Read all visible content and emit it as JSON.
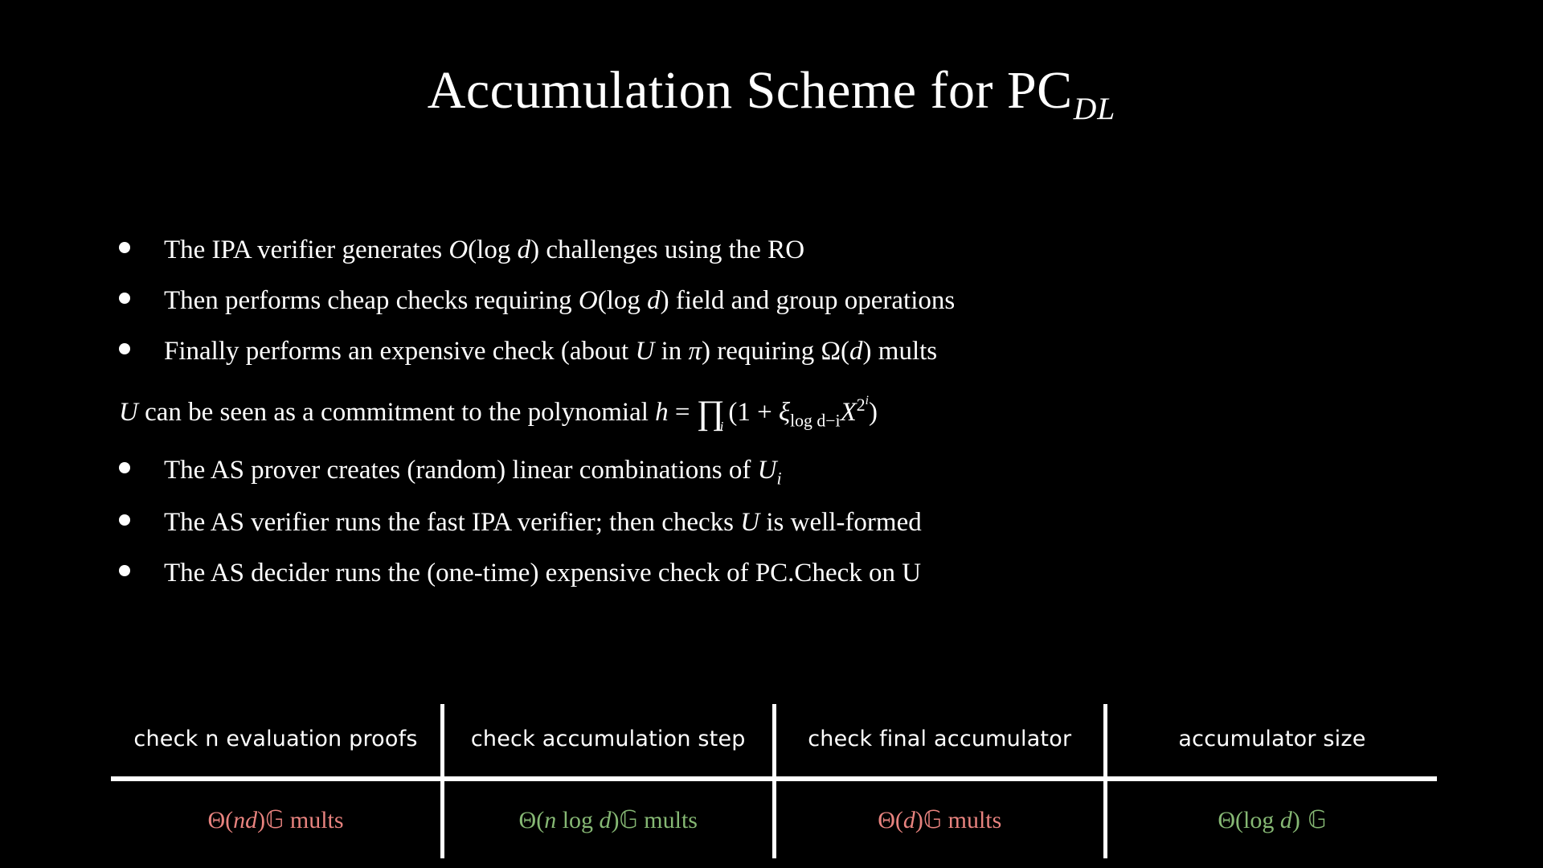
{
  "slide": {
    "background_color": "#000000",
    "text_color": "#ffffff",
    "title_main": "Accumulation Scheme for PC",
    "title_subscript": "DL"
  },
  "bullets": [
    {
      "id": "ipa-verifier-challenges",
      "text_parts": {
        "a": "The IPA verifier generates ",
        "math_O": "O",
        "math_args": "(log ",
        "math_d": "d",
        "math_close": ")",
        "b": " challenges using the RO"
      },
      "plain": "The IPA verifier generates O(log d) challenges using the RO"
    },
    {
      "id": "cheap-checks",
      "text_parts": {
        "a": "Then performs cheap checks requiring ",
        "math_O": "O",
        "math_args": "(log ",
        "math_d": "d",
        "math_close": ")",
        "b": " field and group operations"
      },
      "plain": "Then performs cheap checks requiring O(log d) field and group operations"
    },
    {
      "id": "expensive-check",
      "text_parts": {
        "a": "Finally performs an expensive check (about ",
        "math_U": "U",
        "b": " in ",
        "math_pi": "π",
        "c": ") requiring ",
        "math_omega": "Ω",
        "math_open": "(",
        "math_d": "d",
        "math_close": ")",
        "d": " mults"
      },
      "plain": "Finally performs an expensive check (about U in π) requiring Ω(d) mults"
    },
    {
      "id": "as-prover",
      "text_parts": {
        "a": "The AS prover creates (random) linear combinations of ",
        "math_U": "U",
        "math_sub_i": "i"
      },
      "plain": "The AS prover creates (random) linear combinations of U_i"
    },
    {
      "id": "as-verifier",
      "text_parts": {
        "a": "The AS verifier runs the fast IPA verifier; then checks ",
        "math_U": "U",
        "b": " is well-formed"
      },
      "plain": "The AS verifier runs the fast IPA verifier; then checks U is well-formed"
    },
    {
      "id": "as-decider",
      "text_parts": {
        "a": "The AS decider runs the (one-time) expensive check of PC.Check on U"
      },
      "plain": "The AS decider runs the (one-time) expensive check of PC.Check on U"
    }
  ],
  "commitment_line": {
    "id": "commitment-statement",
    "lead_U": "U",
    "lead_text": " can be seen as a commitment to the polynomial ",
    "math_h": "h",
    "math_eq": " = ",
    "math_prod": "∏",
    "math_prod_index": "i",
    "math_open": "(1 + ",
    "math_xi": "ξ",
    "math_xi_sub": "log d−i",
    "math_X": "X",
    "math_X_exp_base": "2",
    "math_X_exp_exp": "i",
    "math_close": ")",
    "plain": "U can be seen as a commitment to the polynomial h = ∏_i (1 + ξ_{log d−i} X^{2^i})"
  },
  "table": {
    "columns": [
      {
        "header": "check n evaluation proofs",
        "value_parts": {
          "theta": "Θ",
          "open": "(",
          "arg_italic": "nd",
          "close": ")",
          "group": "𝔾",
          "unit": " mults"
        },
        "value_plain": "Θ(nd) 𝔾 mults",
        "color": "#e8837f",
        "color_name": "red"
      },
      {
        "header": "check accumulation step",
        "value_parts": {
          "theta": "Θ",
          "open": "(",
          "arg_italic": "n",
          "arg_mid": " log ",
          "arg_italic2": "d",
          "close": ")",
          "group": "𝔾",
          "unit": " mults"
        },
        "value_plain": "Θ(n log d) 𝔾 mults",
        "color": "#86b874",
        "color_name": "green"
      },
      {
        "header": "check final accumulator",
        "value_parts": {
          "theta": "Θ",
          "open": "(",
          "arg_italic": "d",
          "close": ")",
          "group": "𝔾",
          "unit": " mults"
        },
        "value_plain": "Θ(d) 𝔾 mults",
        "color": "#e8837f",
        "color_name": "red"
      },
      {
        "header": "accumulator size",
        "value_parts": {
          "theta": "Θ",
          "open": "(log ",
          "arg_italic": "d",
          "close": ")",
          "group": " 𝔾",
          "unit": ""
        },
        "value_plain": "Θ(log d) 𝔾",
        "color": "#86b874",
        "color_name": "green"
      }
    ]
  }
}
